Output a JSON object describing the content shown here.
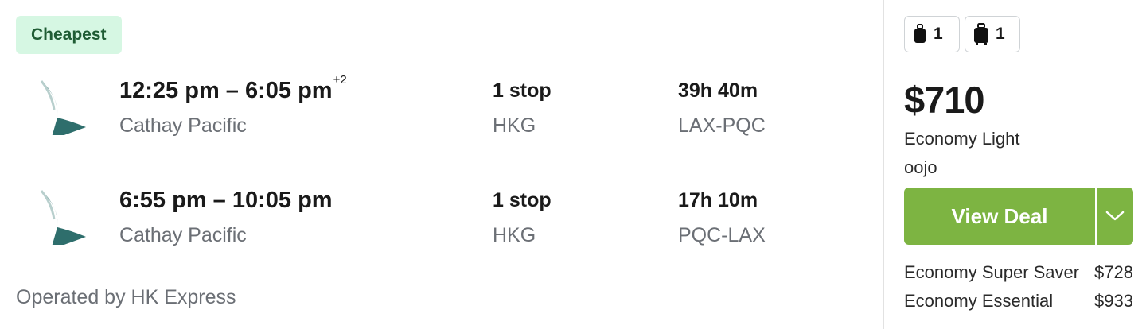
{
  "badge": "Cheapest",
  "legs": [
    {
      "times": "12:25 pm – 6:05 pm",
      "day_offset": "+2",
      "airline": "Cathay Pacific",
      "stops": "1 stop",
      "via": "HKG",
      "duration": "39h 40m",
      "route": "LAX-PQC",
      "logo_icon": "cathay-pacific-logo"
    },
    {
      "times": "6:55 pm – 10:05 pm",
      "day_offset": "",
      "airline": "Cathay Pacific",
      "stops": "1 stop",
      "via": "HKG",
      "duration": "17h 10m",
      "route": "PQC-LAX",
      "logo_icon": "cathay-pacific-logo"
    }
  ],
  "operated_by": "Operated by HK Express",
  "bags": {
    "personal_item_count": "1",
    "carry_on_count": "1",
    "personal_item_icon": "personal-bag-icon",
    "carry_on_icon": "carry-on-bag-icon"
  },
  "price": "$710",
  "fare_class": "Economy Light",
  "provider": "oojo",
  "view_deal_label": "View Deal",
  "alternatives": [
    {
      "name": "Economy Super Saver",
      "price": "$728"
    },
    {
      "name": "Economy Essential",
      "price": "$933"
    }
  ],
  "colors": {
    "accent_green": "#7db442",
    "badge_bg": "#d6f7e3",
    "badge_text": "#1f5c34",
    "logo_teal": "#2e6e6c"
  }
}
